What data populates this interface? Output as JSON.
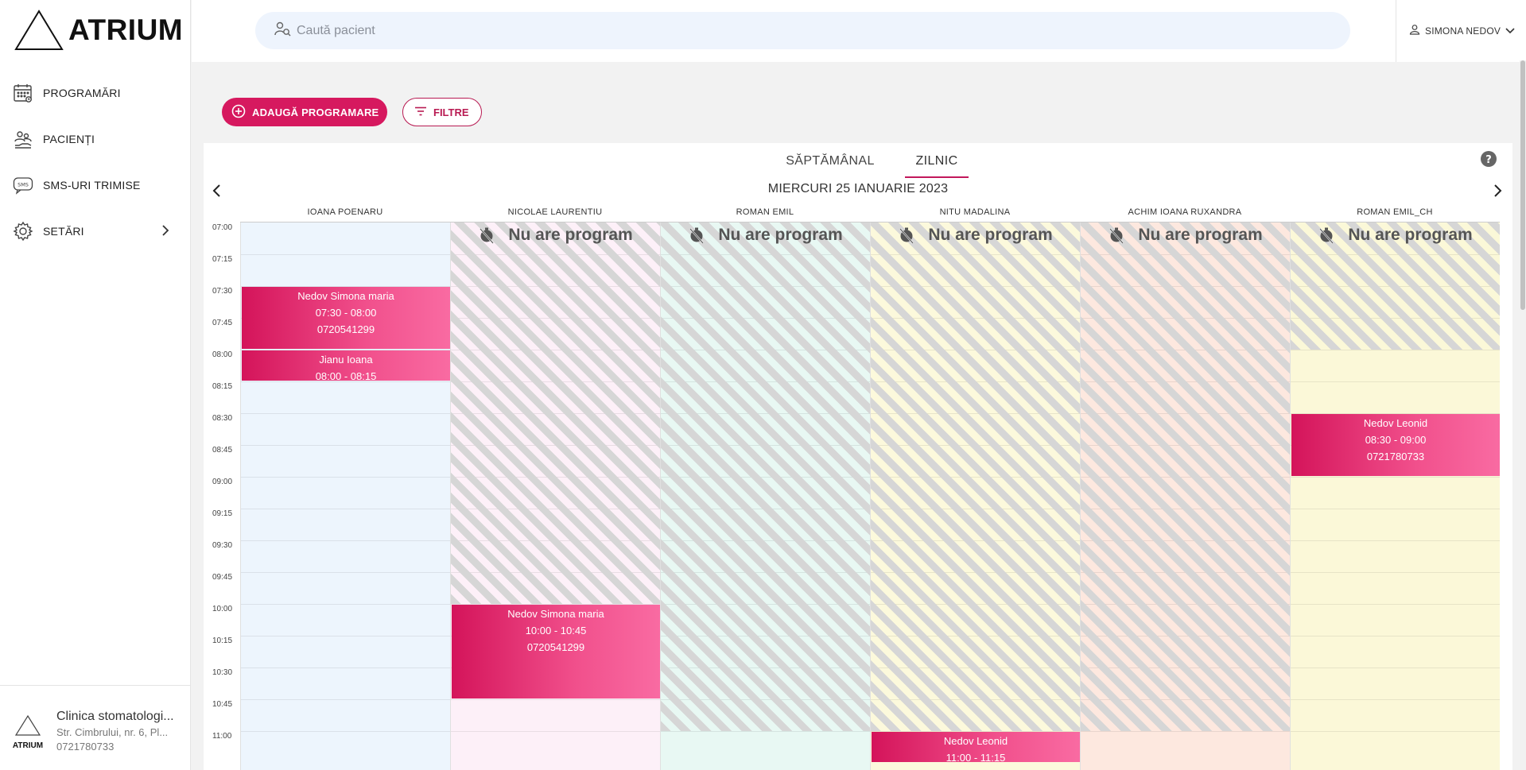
{
  "app": {
    "brand": "ATRIUM"
  },
  "sidebar": {
    "items": [
      {
        "label": "PROGRAMĂRI",
        "icon": "calendar-icon"
      },
      {
        "label": "PACIENȚI",
        "icon": "patients-icon"
      },
      {
        "label": "SMS-URI TRIMISE",
        "icon": "sms-icon"
      },
      {
        "label": "SETĂRI",
        "icon": "gear-icon"
      }
    ],
    "sms_icon_text": "SMS"
  },
  "clinic": {
    "name": "Clinica stomatologi...",
    "address": "Str. Cimbrului, nr. 6, Pl...",
    "phone": "0721780733",
    "logo_text": "ATRIUM"
  },
  "search": {
    "placeholder": "Caută pacient",
    "value": ""
  },
  "user": {
    "name": "SIMONA NEDOV"
  },
  "toolbar": {
    "add_label": "ADAUGĂ PROGRAMARE",
    "filter_label": "FILTRE"
  },
  "calendar": {
    "tabs": [
      {
        "label": "SĂPTĂMÂNAL",
        "active": false
      },
      {
        "label": "ZILNIC",
        "active": true
      }
    ],
    "date_label": "MIERCURI 25 IANUARIE 2023",
    "time_slots": [
      "07:00",
      "07:15",
      "07:30",
      "07:45",
      "08:00",
      "08:15",
      "08:30",
      "08:45",
      "09:00",
      "09:15",
      "09:30",
      "09:45",
      "10:00",
      "10:15",
      "10:30",
      "10:45",
      "11:00"
    ],
    "unavailable_label": "Nu are program",
    "columns": [
      {
        "name": "IOANA POENARU",
        "bg": "#edf5fd",
        "unavailable": null,
        "events": [
          {
            "patient": "Nedov Simona maria",
            "time": "07:30 - 08:00",
            "phone": "0720541299",
            "start": "07:30",
            "end": "08:00"
          },
          {
            "patient": "Jianu Ioana",
            "time": "08:00 - 08:15",
            "phone": "",
            "start": "08:00",
            "end": "08:15"
          }
        ]
      },
      {
        "name": "NICOLAE LAURENTIU",
        "bg": "#fdf0f8",
        "unavailable": [
          "07:00",
          "10:00"
        ],
        "events": [
          {
            "patient": "Nedov Simona maria",
            "time": "10:00 - 10:45",
            "phone": "0720541299",
            "start": "10:00",
            "end": "10:45"
          }
        ]
      },
      {
        "name": "ROMAN EMIL",
        "bg": "#e8f8f3",
        "unavailable": [
          "07:00",
          "11:00"
        ],
        "events": []
      },
      {
        "name": "NITU MADALINA",
        "bg": "#fcf9dc",
        "unavailable": [
          "07:00",
          "11:00"
        ],
        "events": [
          {
            "patient": "Nedov Leonid",
            "time": "11:00 - 11:15",
            "phone": "",
            "start": "11:00",
            "end": "11:15"
          }
        ]
      },
      {
        "name": "ACHIM IOANA RUXANDRA",
        "bg": "#fde8df",
        "unavailable": [
          "07:00",
          "11:00"
        ],
        "events": []
      },
      {
        "name": "ROMAN EMIL_CH",
        "bg": "#fbf8d8",
        "unavailable": [
          "07:00",
          "08:00"
        ],
        "events": [
          {
            "patient": "Nedov Leonid",
            "time": "08:30 - 09:00",
            "phone": "0721780733",
            "start": "08:30",
            "end": "09:00"
          }
        ]
      }
    ]
  },
  "colors": {
    "accent": "#d6195f",
    "accent_dark": "#b81a52",
    "stripe": "#d6d6d6"
  }
}
